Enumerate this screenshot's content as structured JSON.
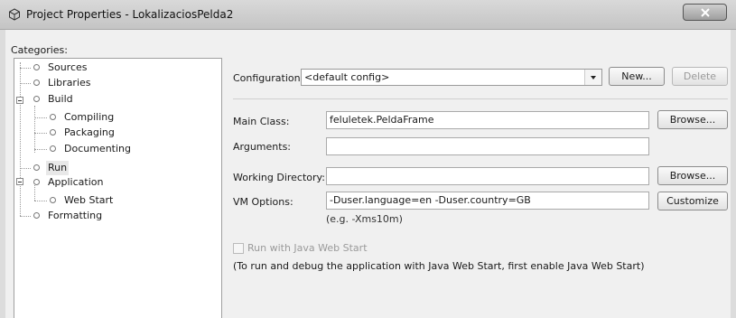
{
  "window": {
    "title": "Project Properties - LokalizaciosPelda2"
  },
  "categories": {
    "label": "Categories:",
    "items": [
      {
        "label": "Sources"
      },
      {
        "label": "Libraries"
      },
      {
        "label": "Build"
      },
      {
        "label": "Compiling"
      },
      {
        "label": "Packaging"
      },
      {
        "label": "Documenting"
      },
      {
        "label": "Run",
        "selected": true
      },
      {
        "label": "Application"
      },
      {
        "label": "Web Start"
      },
      {
        "label": "Formatting"
      }
    ]
  },
  "run": {
    "configuration_label": "Configuration:",
    "configuration_value": "<default config>",
    "new_button": "New...",
    "delete_button": "Delete",
    "main_class_label": "Main Class:",
    "main_class_value": "feluletek.PeldaFrame",
    "browse_button": "Browse...",
    "arguments_label": "Arguments:",
    "arguments_value": "",
    "working_dir_label": "Working Directory:",
    "working_dir_value": "",
    "browse_button_2": "Browse...",
    "vm_options_label": "VM Options:",
    "vm_options_value": "-Duser.language=en -Duser.country=GB",
    "customize_button": "Customize",
    "vm_hint": "(e.g. -Xms10m)",
    "web_start_checkbox_label": "Run with Java Web Start",
    "web_start_note": "(To run and debug the application with Java Web Start, first enable Java Web Start)"
  }
}
